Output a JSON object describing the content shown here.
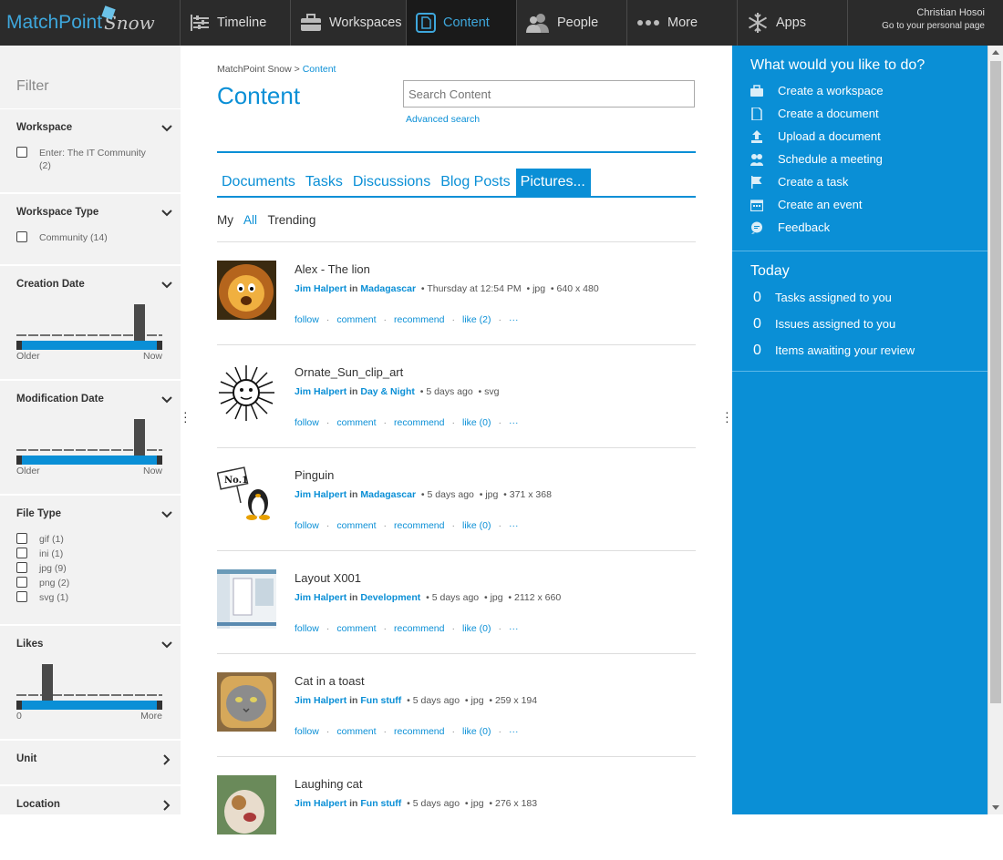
{
  "app": {
    "logo_main": "MatchPoint",
    "logo_sub": "Snow"
  },
  "nav": [
    {
      "label": "Timeline",
      "icon": "timeline-icon"
    },
    {
      "label": "Workspaces",
      "icon": "briefcase-icon"
    },
    {
      "label": "Content",
      "icon": "document-icon",
      "active": true
    },
    {
      "label": "People",
      "icon": "people-icon"
    },
    {
      "label": "More",
      "icon": "more-dots-icon"
    },
    {
      "label": "Apps",
      "icon": "snowflake-icon"
    }
  ],
  "user": {
    "name": "Christian Hosoi",
    "sub": "Go to your personal page"
  },
  "sidebar": {
    "title": "Filter",
    "workspace": {
      "title": "Workspace",
      "option": "Enter: The IT Community",
      "option_count": "(2)"
    },
    "workspace_type": {
      "title": "Workspace Type",
      "option": "Community (14)"
    },
    "creation_date": {
      "title": "Creation Date",
      "lo": "Older",
      "hi": "Now"
    },
    "modification_date": {
      "title": "Modification Date",
      "lo": "Older",
      "hi": "Now"
    },
    "file_type": {
      "title": "File Type",
      "options": [
        "gif (1)",
        "ini (1)",
        "jpg (9)",
        "png (2)",
        "svg (1)"
      ]
    },
    "likes": {
      "title": "Likes",
      "lo": "0",
      "hi": "More"
    },
    "unit": {
      "title": "Unit"
    },
    "location": {
      "title": "Location"
    }
  },
  "main": {
    "breadcrumb_root": "MatchPoint Snow",
    "breadcrumb_sep": ">",
    "breadcrumb_current": "Content",
    "title": "Content",
    "search_placeholder": "Search Content",
    "advanced": "Advanced search",
    "tabs": [
      "Documents",
      "Tasks",
      "Discussions",
      "Blog Posts",
      "Pictures..."
    ],
    "subtabs": [
      "My",
      "All",
      "Trending"
    ],
    "items": [
      {
        "title": "Alex - The lion",
        "author": "Jim Halpert",
        "in": "in",
        "place": "Madagascar",
        "time": "Thursday at 12:54 PM",
        "type": "jpg",
        "size": "640 x 480",
        "like": "like (2)"
      },
      {
        "title": "Ornate_Sun_clip_art",
        "author": "Jim Halpert",
        "in": "in",
        "place": "Day & Night",
        "time": "5 days ago",
        "type": "svg",
        "size": "",
        "like": "like (0)"
      },
      {
        "title": "Pinguin",
        "author": "Jim Halpert",
        "in": "in",
        "place": "Madagascar",
        "time": "5 days ago",
        "type": "jpg",
        "size": "371 x 368",
        "like": "like (0)"
      },
      {
        "title": "Layout X001",
        "author": "Jim Halpert",
        "in": "in",
        "place": "Development",
        "time": "5 days ago",
        "type": "jpg",
        "size": "2112 x 660",
        "like": "like (0)"
      },
      {
        "title": "Cat in a toast",
        "author": "Jim Halpert",
        "in": "in",
        "place": "Fun stuff",
        "time": "5 days ago",
        "type": "jpg",
        "size": "259 x 194",
        "like": "like (0)"
      },
      {
        "title": "Laughing cat",
        "author": "Jim Halpert",
        "in": "in",
        "place": "Fun stuff",
        "time": "5 days ago",
        "type": "jpg",
        "size": "276 x 183",
        "like": ""
      }
    ],
    "actions": {
      "follow": "follow",
      "comment": "comment",
      "recommend": "recommend",
      "more": "···"
    }
  },
  "right": {
    "title": "What would you like to do?",
    "actions": [
      "Create a workspace",
      "Create a document",
      "Upload a document",
      "Schedule a meeting",
      "Create a task",
      "Create an event",
      "Feedback"
    ],
    "today_title": "Today",
    "today": [
      {
        "num": "0",
        "label": "Tasks assigned to you"
      },
      {
        "num": "0",
        "label": "Issues assigned to you"
      },
      {
        "num": "0",
        "label": "Items awaiting your review"
      }
    ]
  },
  "colors": {
    "accent": "#0a8fd6",
    "topbar": "#2b2b2b",
    "sidebar": "#f2f2f2"
  }
}
